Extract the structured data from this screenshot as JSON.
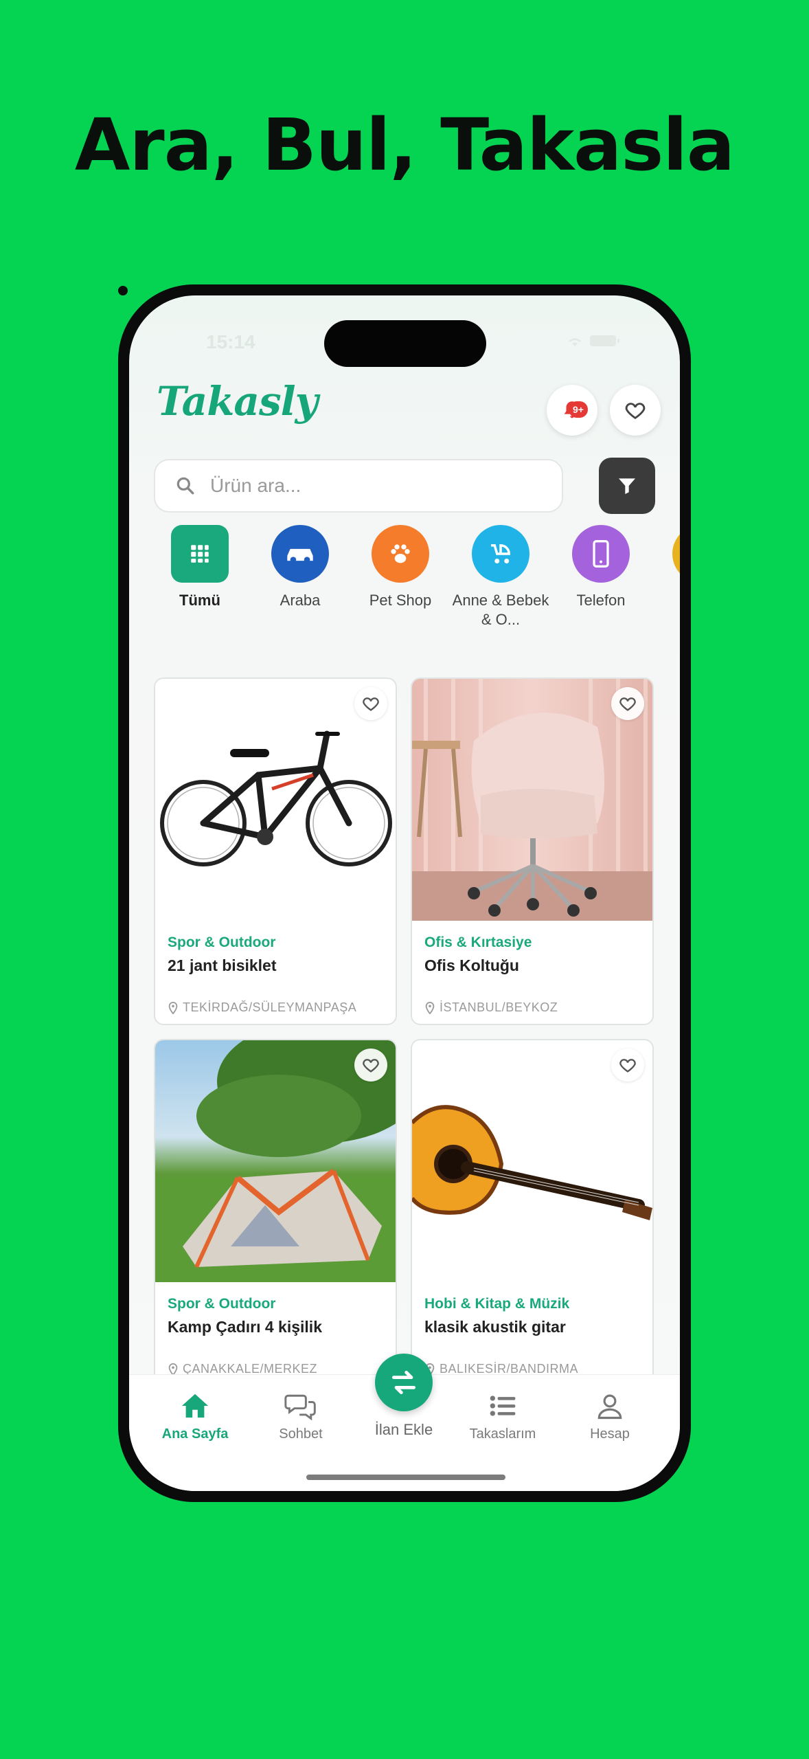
{
  "headline": "Ara, Bul, Takasla",
  "status": {
    "time": "15:14"
  },
  "app": {
    "logo": "Takasly",
    "notification_badge": "9+"
  },
  "search": {
    "placeholder": "Ürün ara..."
  },
  "categories": [
    {
      "label": "Tümü",
      "icon": "grid-icon",
      "color": "#1aa97c",
      "active": true
    },
    {
      "label": "Araba",
      "icon": "car-icon",
      "color": "#1f5fc0"
    },
    {
      "label": "Pet Shop",
      "icon": "paw-icon",
      "color": "#f57c2a"
    },
    {
      "label": "Anne & Bebek & O...",
      "icon": "stroller-icon",
      "color": "#1fb3e8"
    },
    {
      "label": "Telefon",
      "icon": "phone-icon",
      "color": "#a463dd"
    }
  ],
  "products": [
    {
      "category": "Spor & Outdoor",
      "title": "21 jant bisiklet",
      "location": "TEKİRDAĞ/SÜLEYMANPAŞA"
    },
    {
      "category": "Ofis & Kırtasiye",
      "title": "Ofis Koltuğu",
      "location": "İSTANBUL/BEYKOZ"
    },
    {
      "category": "Spor & Outdoor",
      "title": "Kamp Çadırı 4 kişilik",
      "location": "ÇANAKKALE/MERKEZ"
    },
    {
      "category": "Hobi & Kitap & Müzik",
      "title": "klasik akustik gitar",
      "location": "BALIKESİR/BANDIRMA"
    }
  ],
  "tabbar": {
    "home": "Ana Sayfa",
    "chat": "Sohbet",
    "add": "İlan Ekle",
    "swaps": "Takaslarım",
    "account": "Hesap"
  },
  "colors": {
    "background": "#04d452",
    "accent": "#16a77a"
  }
}
